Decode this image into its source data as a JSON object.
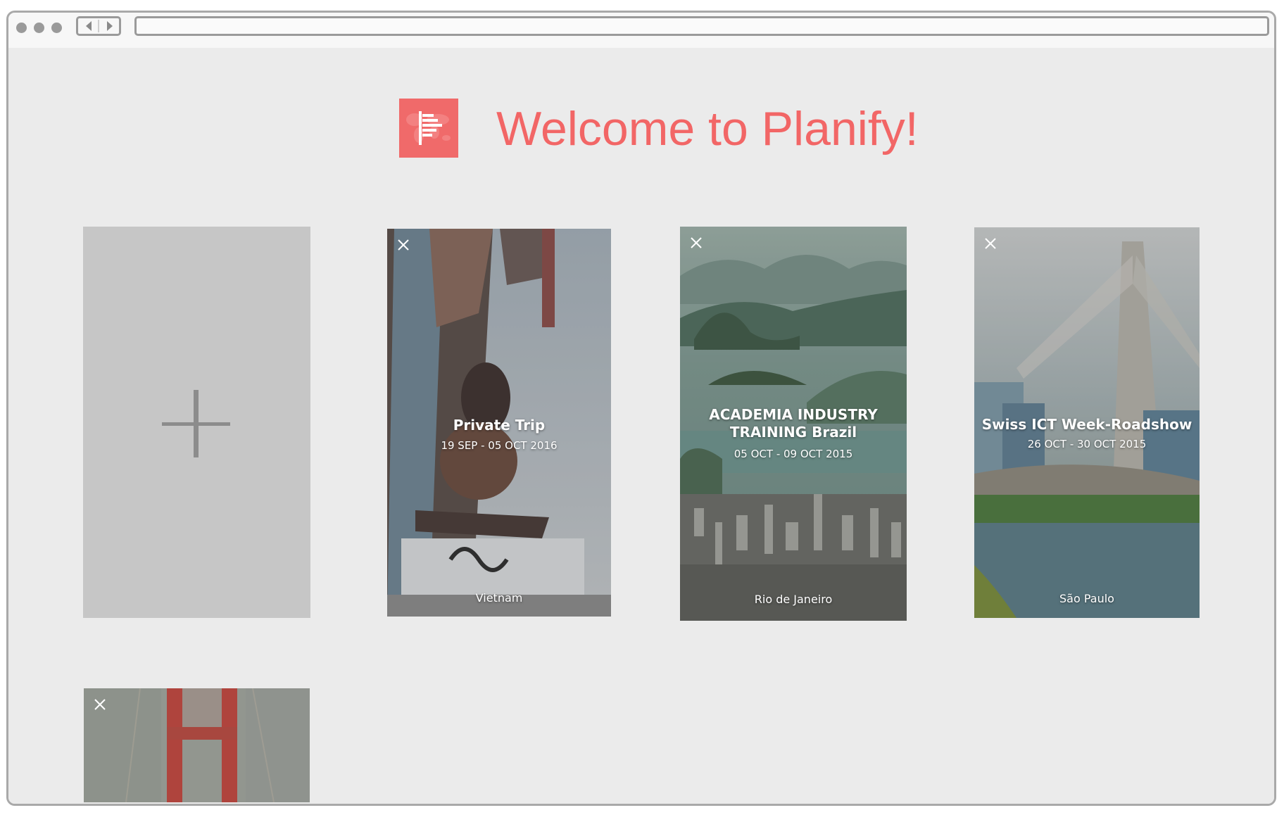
{
  "header": {
    "title": "Welcome to Planify!"
  },
  "add_card": {
    "icon": "plus-icon"
  },
  "trips": [
    {
      "title": "Private Trip",
      "dates": "19 SEP - 05 OCT 2016",
      "place": "Vietnam"
    },
    {
      "title": "ACADEMIA INDUSTRY TRAINING Brazil",
      "dates": "05 OCT - 09 OCT 2015",
      "place": "Rio de Janeiro"
    },
    {
      "title": "Swiss ICT Week-Roadshow",
      "dates": "26 OCT - 30 OCT 2015",
      "place": "São Paulo"
    },
    {
      "title": "",
      "dates": "",
      "place": ""
    }
  ],
  "colors": {
    "brand": "#f06a6a",
    "background": "#ebebeb",
    "add_card": "#c6c6c6"
  }
}
